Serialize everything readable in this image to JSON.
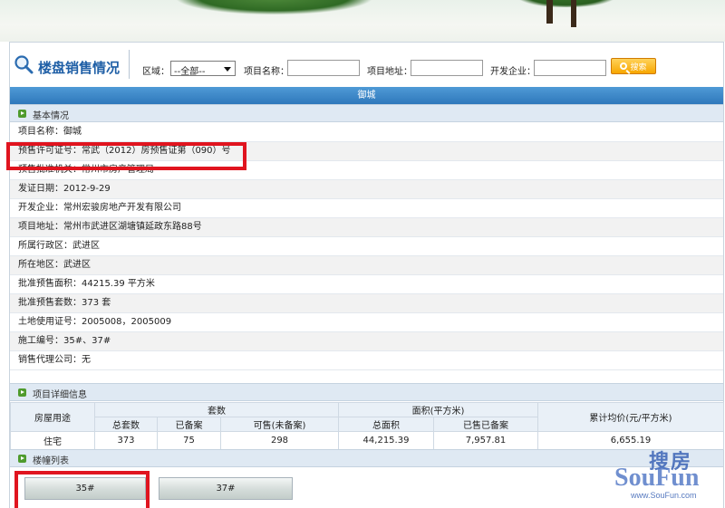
{
  "search": {
    "heading": "楼盘销售情况",
    "district_label": "区域：",
    "district_value": "--全部--",
    "project_name_label": "项目名称：",
    "project_name_value": "",
    "project_address_label": "项目地址：",
    "project_address_value": "",
    "developer_label": "开发企业：",
    "developer_value": "",
    "search_button": "搜索"
  },
  "project_title": "御城",
  "basic": {
    "section_label": "基本情况",
    "rows": [
      {
        "label": "项目名称：",
        "value": "御城"
      },
      {
        "label": "预售许可证号：",
        "value": "常武（2012）房预售证第（090）号"
      },
      {
        "label": "预售批准机关：",
        "value": "常州市房产管理局"
      },
      {
        "label": "发证日期：",
        "value": "2012-9-29"
      },
      {
        "label": "开发企业：",
        "value": "常州宏骏房地产开发有限公司"
      },
      {
        "label": "项目地址：",
        "value": "常州市武进区湖塘镇延政东路88号"
      },
      {
        "label": "所属行政区：",
        "value": "武进区"
      },
      {
        "label": "所在地区：",
        "value": "武进区"
      },
      {
        "label": "批准预售面积：",
        "value": "44215.39 平方米"
      },
      {
        "label": "批准预售套数：",
        "value": "373 套"
      },
      {
        "label": "土地使用证号：",
        "value": "2005008，2005009"
      },
      {
        "label": "施工编号：",
        "value": "35#、37#"
      },
      {
        "label": "销售代理公司：",
        "value": "无"
      }
    ]
  },
  "detail": {
    "section_label": "项目详细信息",
    "headers": {
      "usage": "房屋用途",
      "units_group": "套数",
      "area_group": "面积(平方米)",
      "avg_price": "累计均价(元/平方米)",
      "total_units": "总套数",
      "filed_units": "已备案",
      "available_units": "可售(未备案)",
      "total_area": "总面积",
      "sold_filed_area": "已售已备案"
    },
    "row": {
      "usage": "住宅",
      "total_units": "373",
      "filed_units": "75",
      "available_units": "298",
      "total_area": "44,215.39",
      "sold_filed_area": "7,957.81",
      "avg_price": "6,655.19"
    }
  },
  "buildings": {
    "section_label": "楼幢列表",
    "items": [
      "35#",
      "37#"
    ]
  },
  "watermark": {
    "cn": "搜房",
    "en": "SouFun",
    "url": "www.SouFun.com"
  },
  "colors": {
    "title_bar": "#2f78bb",
    "heading": "#1f5fa6",
    "highlight": "#e0141f",
    "search_button": "#f7a600"
  }
}
